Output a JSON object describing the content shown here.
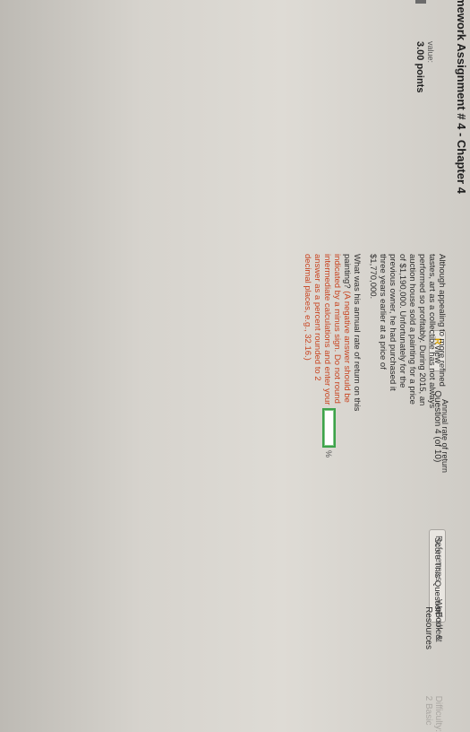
{
  "header": {
    "assignment_title": "mework Assignment # 4 - Chapter 4",
    "review_label": "view",
    "review_flag": "R",
    "question_indicator": "Question 4 (of 10)",
    "score_button": "Score This Question"
  },
  "sidebar": {
    "value_label": "value:",
    "points": "3.00 points"
  },
  "question": {
    "paragraph1": "Although appealing to more refined tastes, art as a collectible has not always performed so profitably. During 2015, an auction house sold a painting for a price of $1,190,000. Unfortunately for the previous owner, he had purchased it three years earlier at a price of $1,770,000.",
    "prompt": "What was his annual rate of return on this painting?",
    "instructions": "(A negative answer should be indicated by a minus sign. Do not round intermediate calculations and enter your answer as a percent rounded to 2 decimal places, e.g., 32.16.)"
  },
  "answer": {
    "label": "Annual rate of return",
    "value": "",
    "unit": "%"
  },
  "tabs": {
    "references": "References",
    "ebook": "eBook & Resources"
  },
  "footer": {
    "worksheet": "Worksheet",
    "difficulty": "Difficulty: 2 Basic"
  },
  "colors": {
    "input_border": "#3da24a",
    "instruction_text": "#c8431f",
    "review_flag": "#d7a000"
  }
}
